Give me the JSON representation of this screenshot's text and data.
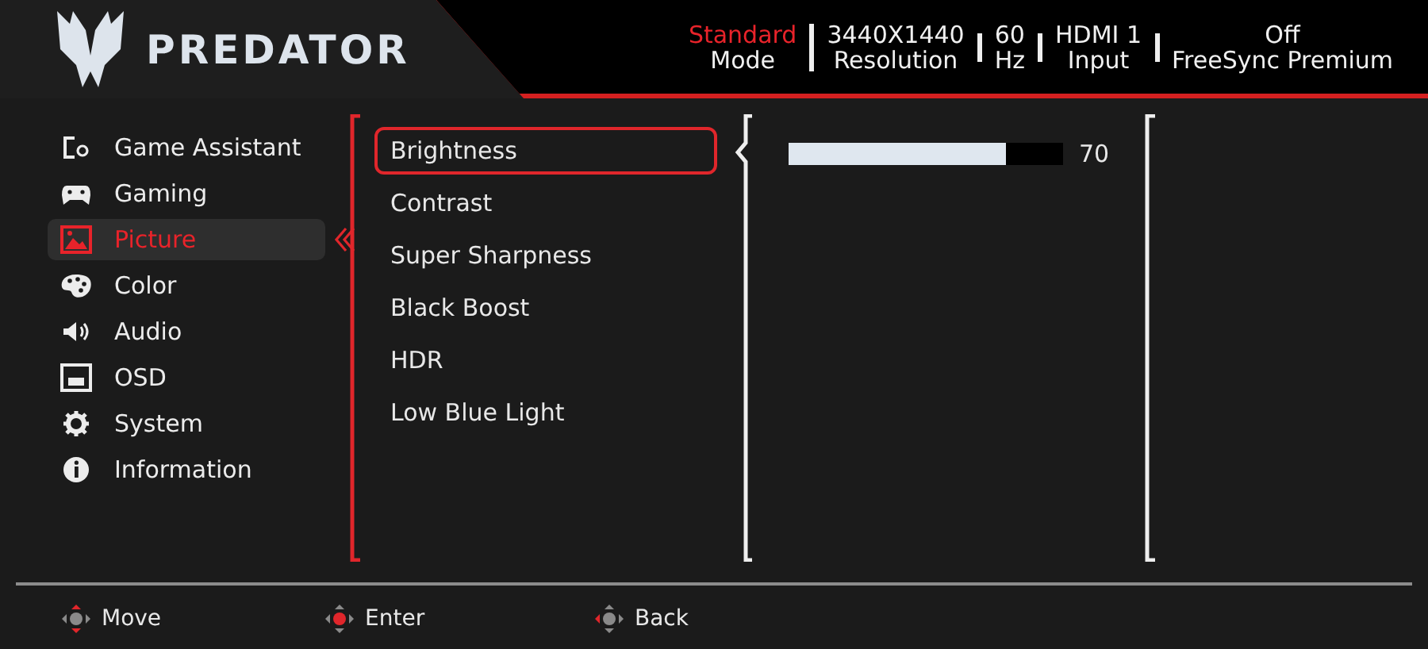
{
  "header": {
    "logo_text": "PREDATOR",
    "stats": [
      {
        "value": "Standard",
        "label": "Mode",
        "highlighted": true
      },
      {
        "value": "3440X1440",
        "label": "Resolution",
        "highlighted": false
      },
      {
        "value": "60",
        "label": "Hz",
        "highlighted": false
      },
      {
        "value": "HDMI 1",
        "label": "Input",
        "highlighted": false
      },
      {
        "value": "Off",
        "label": "FreeSync Premium",
        "highlighted": false
      }
    ]
  },
  "sidebar": {
    "items": [
      {
        "label": "Game Assistant",
        "selected": false
      },
      {
        "label": "Gaming",
        "selected": false
      },
      {
        "label": "Picture",
        "selected": true
      },
      {
        "label": "Color",
        "selected": false
      },
      {
        "label": "Audio",
        "selected": false
      },
      {
        "label": "OSD",
        "selected": false
      },
      {
        "label": "System",
        "selected": false
      },
      {
        "label": "Information",
        "selected": false
      }
    ]
  },
  "submenu": {
    "items": [
      {
        "label": "Brightness",
        "selected": true
      },
      {
        "label": "Contrast",
        "selected": false
      },
      {
        "label": "Super Sharpness",
        "selected": false
      },
      {
        "label": "Black Boost",
        "selected": false
      },
      {
        "label": "HDR",
        "selected": false
      },
      {
        "label": "Low Blue Light",
        "selected": false
      }
    ]
  },
  "setting": {
    "level": 0.79,
    "reading": "70"
  },
  "footer": {
    "hints": [
      {
        "kind": "move",
        "label": "Move"
      },
      {
        "kind": "enter",
        "label": "Enter"
      },
      {
        "kind": "back",
        "label": "Back"
      }
    ]
  }
}
